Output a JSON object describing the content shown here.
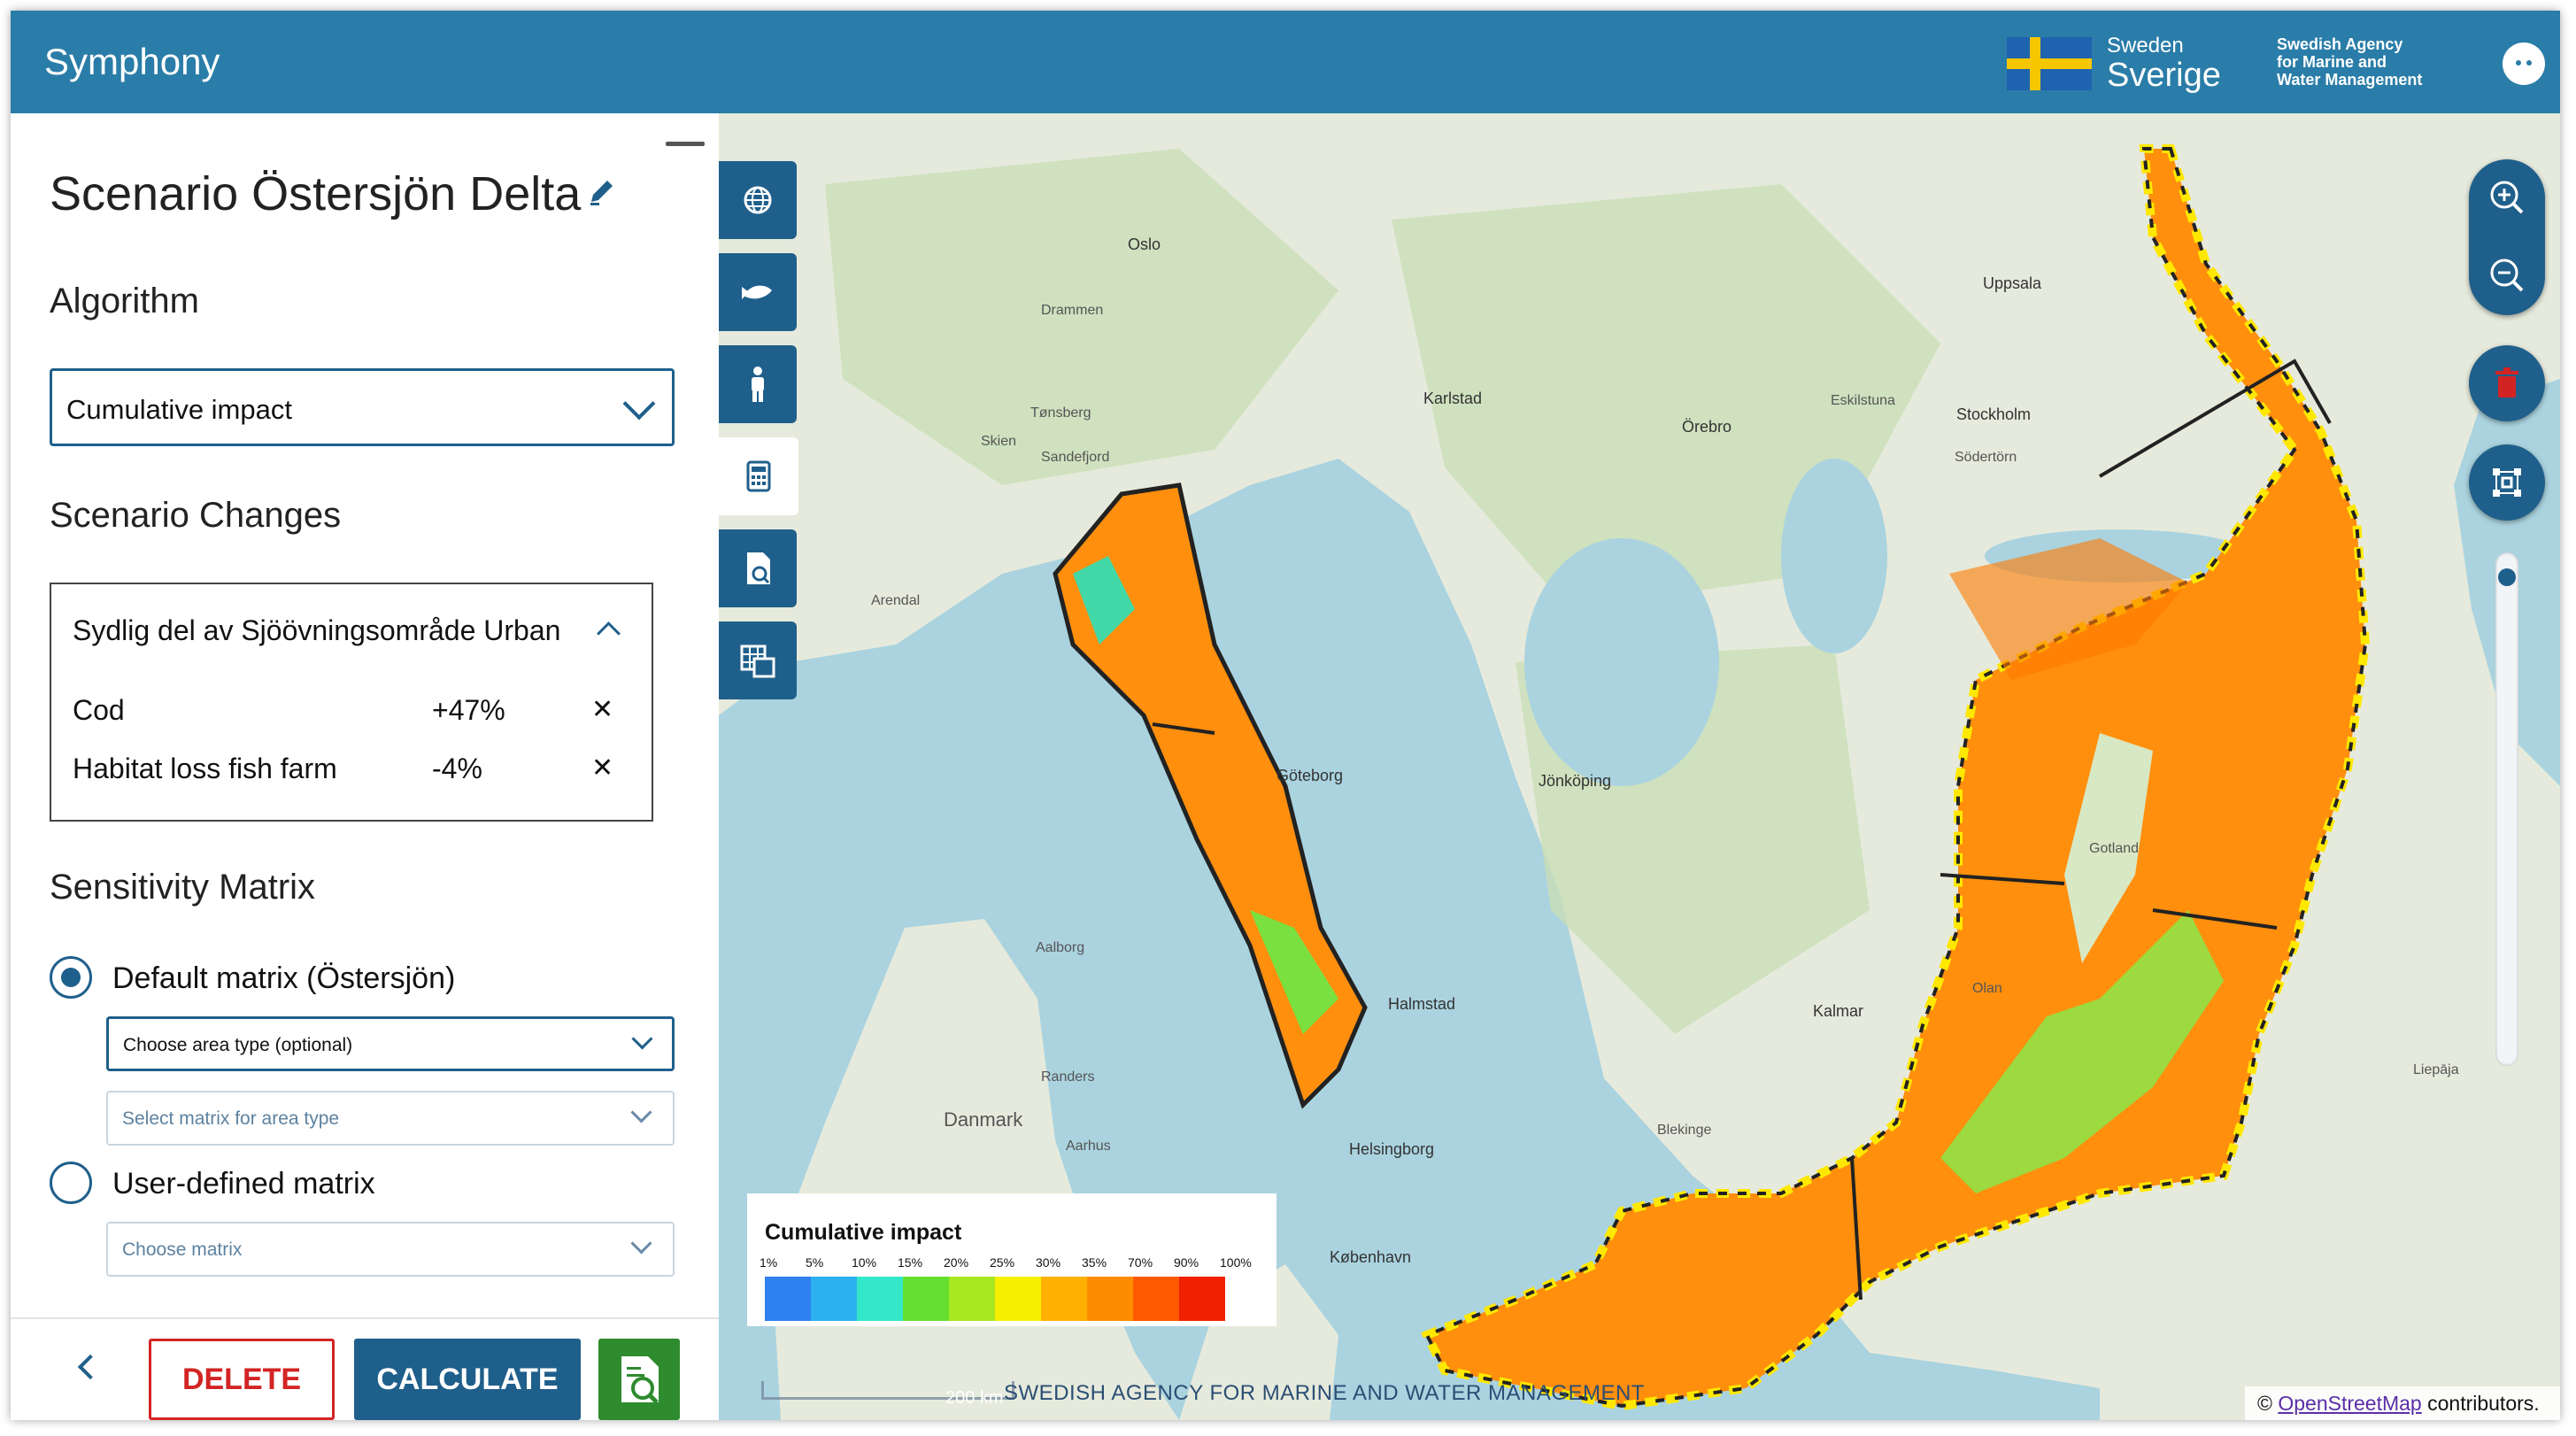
{
  "header": {
    "app_title": "Symphony",
    "brand_small": "Sweden",
    "brand_large": "Sverige",
    "agency": "Swedish Agency for Marine and Water Management",
    "header_color": "#2a7da8"
  },
  "panel": {
    "scenario_title": "Scenario Östersjön Delta",
    "algorithm_heading": "Algorithm",
    "algorithm_value": "Cumulative impact",
    "changes_heading": "Scenario Changes",
    "change_area": "Sydlig del av Sjöövningsområde Urban",
    "changes": [
      {
        "name": "Cod",
        "value": "+47%"
      },
      {
        "name": "Habitat loss fish farm",
        "value": "-4%"
      }
    ],
    "matrix_heading": "Sensitivity Matrix",
    "default_matrix_label": "Default matrix (Östersjön)",
    "area_type_placeholder": "Choose area type (optional)",
    "matrix_for_area_placeholder": "Select matrix for area type",
    "user_matrix_label": "User-defined matrix",
    "choose_matrix_placeholder": "Choose matrix",
    "selected_matrix": "default"
  },
  "footer": {
    "delete_label": "DELETE",
    "calculate_label": "CALCULATE",
    "accent": "#1f5f8b",
    "danger": "#d32424"
  },
  "tools": [
    "globe-icon",
    "fish-icon",
    "person-icon",
    "calculator-icon",
    "report-icon",
    "grid-icon"
  ],
  "map_controls": [
    "zoom-in-icon",
    "zoom-out-icon",
    "trash-icon",
    "network-icon"
  ],
  "legend": {
    "title": "Cumulative impact",
    "ticks": [
      "1%",
      "5%",
      "10%",
      "15%",
      "20%",
      "25%",
      "30%",
      "35%",
      "70%",
      "90%",
      "100%"
    ],
    "colors": [
      "#2f80f0",
      "#2db0f0",
      "#33e8c8",
      "#66e030",
      "#a8e820",
      "#f6f000",
      "#ffb000",
      "#ff8c00",
      "#ff5a00",
      "#f02000"
    ]
  },
  "map": {
    "scale_label": "200 km",
    "watermark": "SWEDISH AGENCY FOR MARINE AND WATER MANAGEMENT",
    "attribution_prefix": "©",
    "attribution_link": "OpenStreetMap",
    "attribution_suffix": "contributors.",
    "places": [
      {
        "name": "Oslo",
        "cls": "city"
      },
      {
        "name": "Uppsala",
        "cls": "city"
      },
      {
        "name": "Stockholm",
        "cls": "city"
      },
      {
        "name": "Örebro",
        "cls": "city"
      },
      {
        "name": "Karlstad",
        "cls": "city"
      },
      {
        "name": "Jönköping",
        "cls": "city"
      },
      {
        "name": "Göteborg",
        "cls": "city"
      },
      {
        "name": "Halmstad",
        "cls": "city"
      },
      {
        "name": "Helsingborg",
        "cls": "city"
      },
      {
        "name": "København",
        "cls": "city"
      },
      {
        "name": "Kalmar",
        "cls": "city"
      },
      {
        "name": "Danmark",
        "cls": "country"
      },
      {
        "name": "Drammen",
        "cls": ""
      },
      {
        "name": "Tønsberg",
        "cls": ""
      },
      {
        "name": "Sandefjord",
        "cls": ""
      },
      {
        "name": "Skien",
        "cls": ""
      },
      {
        "name": "Arendal",
        "cls": ""
      },
      {
        "name": "Aalborg",
        "cls": ""
      },
      {
        "name": "Randers",
        "cls": ""
      },
      {
        "name": "Aarhus",
        "cls": ""
      },
      {
        "name": "Eskilstuna",
        "cls": ""
      },
      {
        "name": "Södertörn",
        "cls": ""
      },
      {
        "name": "Gotland",
        "cls": ""
      },
      {
        "name": "Liepāja",
        "cls": ""
      },
      {
        "name": "Olan",
        "cls": ""
      },
      {
        "name": "Blekinge",
        "cls": ""
      }
    ]
  }
}
